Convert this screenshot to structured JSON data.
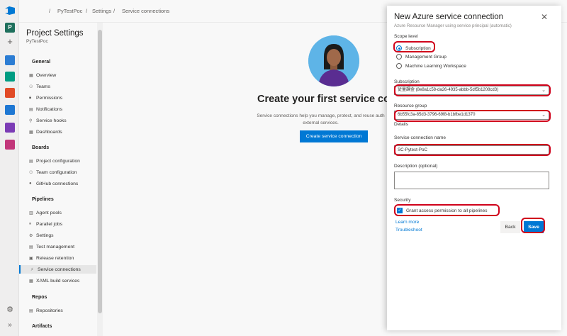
{
  "topbar": {
    "breadcrumb": [
      "PyTestPoc",
      "Settings",
      "Service connections"
    ],
    "sep": "/"
  },
  "rail": {
    "project_initial": "P",
    "icons": [
      "azure-devops-logo",
      "project-avatar",
      "plus-icon",
      "overview-icon",
      "boards-icon",
      "repos-icon",
      "pipelines-icon",
      "test-plans-icon",
      "artifacts-icon",
      "settings-gear-icon",
      "expand-icon"
    ],
    "colors": {
      "overview": "#2b7cd3",
      "boards": "#009c82",
      "repos": "#e14a26",
      "pipelines": "#1e77d3",
      "test": "#7b3bb5",
      "artifacts": "#c2367a"
    }
  },
  "sidebar": {
    "title": "Project Settings",
    "project": "PyTestPoc",
    "general": {
      "label": "General",
      "items": [
        "Overview",
        "Teams",
        "Permissions",
        "Notifications",
        "Service hooks",
        "Dashboards"
      ]
    },
    "boards": {
      "label": "Boards",
      "items": [
        "Project configuration",
        "Team configuration",
        "GitHub connections"
      ]
    },
    "pipelines": {
      "label": "Pipelines",
      "items": [
        "Agent pools",
        "Parallel jobs",
        "Settings",
        "Test management",
        "Release retention",
        "Service connections",
        "XAML build services"
      ]
    },
    "repos": {
      "label": "Repos",
      "items": [
        "Repositories"
      ]
    },
    "artifacts": {
      "label": "Artifacts"
    }
  },
  "main": {
    "heading": "Create your first service conne",
    "description": "Service connections help you manage, protect, and reuse auth external services.",
    "cta": "Create service connection"
  },
  "panel": {
    "title": "New Azure service connection",
    "subtitle": "Azure Resource Manager using service principal (automatic)",
    "scope_label": "Scope level",
    "scope_options": [
      "Subscription",
      "Management Group",
      "Machine Learning Workspace"
    ],
    "scope_selected": "Subscription",
    "subscription_label": "Subscription",
    "subscription_value": "従量課金 (8e8a1c58-da26-4935-abbb-5df5b1208cd3)",
    "resource_group_label": "Resource group",
    "resource_group_value": "6b55fc3a-85d3-3796-69f8-b1bfbe1d1370",
    "details_label": "Details",
    "name_label": "Service connection name",
    "name_value": "SC-Pytest-PoC",
    "description_label": "Description (optional)",
    "description_value": "",
    "security_label": "Security",
    "grant_label": "Grant access permission to all pipelines",
    "grant_checked": true,
    "learn_more": "Learn more",
    "troubleshoot": "Troubleshoot",
    "back_label": "Back",
    "save_label": "Save"
  },
  "colors": {
    "accent": "#0078d4",
    "annotation": "#d0021b"
  }
}
